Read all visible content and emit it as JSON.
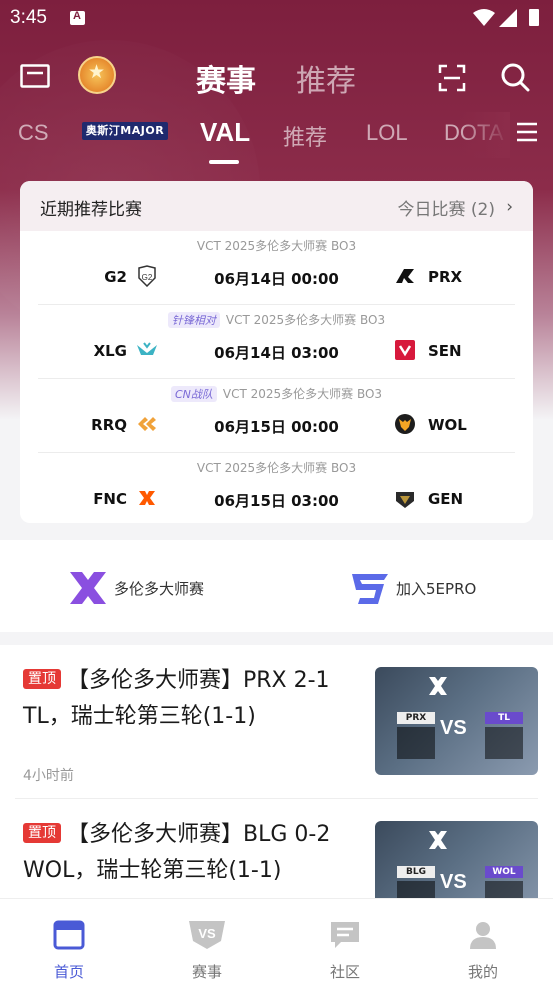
{
  "status_bar": {
    "time": "3:45"
  },
  "top_nav": {
    "tabs": [
      {
        "label": "赛事",
        "active": true
      },
      {
        "label": "推荐",
        "active": false
      }
    ]
  },
  "game_tabs": [
    {
      "label": "CS"
    },
    {
      "label": "奥斯汀MAJOR"
    },
    {
      "label": "VAL",
      "active": true
    },
    {
      "label": "推荐"
    },
    {
      "label": "LOL"
    },
    {
      "label": "DOTA"
    }
  ],
  "recommended": {
    "title": "近期推荐比赛",
    "today_link": "今日比赛 (2)",
    "matches": [
      {
        "tag": "",
        "event": "VCT 2025多伦多大师赛 BO3",
        "team_left": "G2",
        "time": "06月14日 00:00",
        "team_right": "PRX"
      },
      {
        "tag": "针锋相对",
        "event": "VCT 2025多伦多大师赛 BO3",
        "team_left": "XLG",
        "time": "06月14日 03:00",
        "team_right": "SEN"
      },
      {
        "tag": "CN战队",
        "event": "VCT 2025多伦多大师赛 BO3",
        "team_left": "RRQ",
        "time": "06月15日 00:00",
        "team_right": "WOL"
      },
      {
        "tag": "",
        "event": "VCT 2025多伦多大师赛 BO3",
        "team_left": "FNC",
        "time": "06月15日 03:00",
        "team_right": "GEN"
      }
    ]
  },
  "shortcuts": [
    {
      "label": "多伦多大师赛"
    },
    {
      "label": "加入5EPRO"
    }
  ],
  "news": [
    {
      "tag": "置顶",
      "title": "【多伦多大师赛】PRX 2-1 TL，瑞士轮第三轮(1-1)",
      "time": "4小时前",
      "thumb_left": "PRX",
      "thumb_right": "TL",
      "thumb_vs": "VS"
    },
    {
      "tag": "置顶",
      "title": "【多伦多大师赛】BLG 0-2 WOL，瑞士轮第三轮(1-1)",
      "time": "",
      "thumb_left": "BLG",
      "thumb_right": "WOL",
      "thumb_vs": "VS"
    }
  ],
  "tab_bar": [
    {
      "label": "首页",
      "active": true,
      "icon": "home-icon"
    },
    {
      "label": "赛事",
      "active": false,
      "icon": "vs-icon"
    },
    {
      "label": "社区",
      "active": false,
      "icon": "chat-icon"
    },
    {
      "label": "我的",
      "active": false,
      "icon": "user-icon"
    }
  ],
  "colors": {
    "accent": "#4a5ad6",
    "hero": "#7d1f3e",
    "tag_red": "#e53935"
  }
}
